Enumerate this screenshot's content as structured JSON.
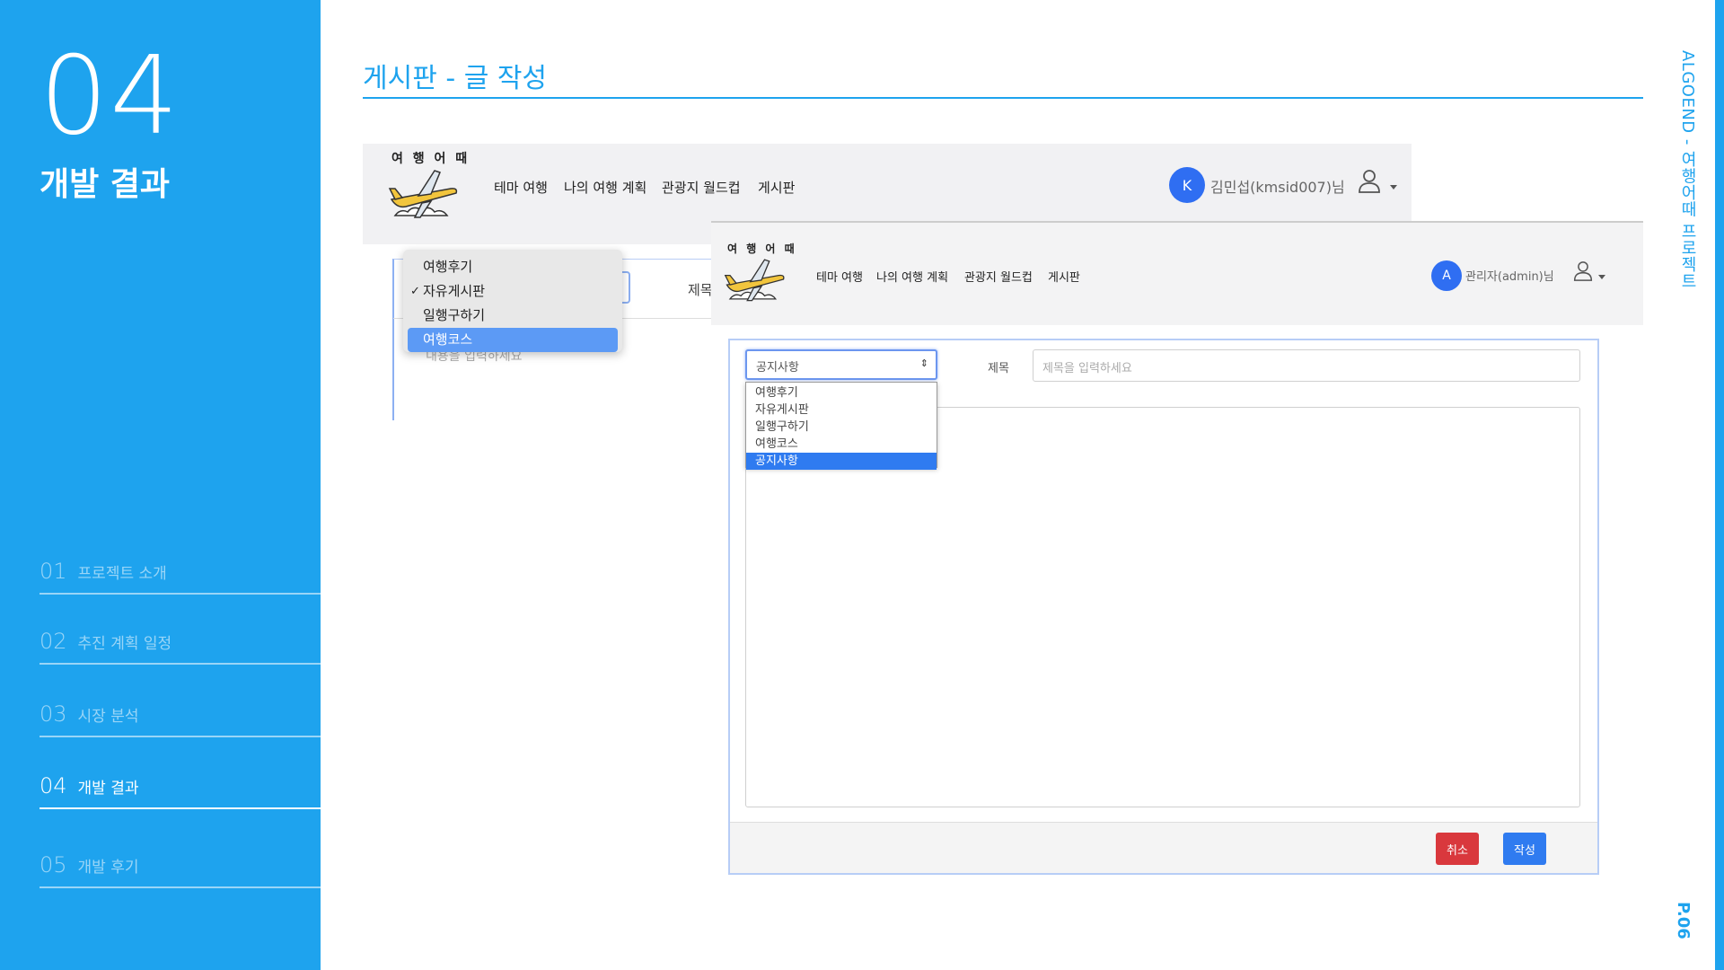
{
  "colors": {
    "accent": "#1ea3ee",
    "avatar_blue": "#2f6ef2",
    "cancel_red": "#d9383d",
    "write_blue": "#2f7bf0"
  },
  "sidebar": {
    "big_number": "04",
    "section_title": "개발 결과",
    "toc": [
      {
        "num": "01",
        "label": "프로젝트 소개"
      },
      {
        "num": "02",
        "label": "추진 계획 일정"
      },
      {
        "num": "03",
        "label": "시장 분석"
      },
      {
        "num": "04",
        "label": "개발 결과"
      },
      {
        "num": "05",
        "label": "개발 후기"
      }
    ],
    "active_index": 3
  },
  "side_label": "ALGOEND - 여행어때 프로젝트",
  "page_number": "P.06",
  "heading": "게시판 - 글 작성",
  "back_screen": {
    "logo_text": "여 행 어 때",
    "nav": [
      "테마 여행",
      "나의 여행 계획",
      "관광지 월드컵",
      "게시판"
    ],
    "avatar_letter": "K",
    "user_name": "김민섭(kmsid007)님",
    "title_label": "제목",
    "placeholder": "내용을 입력하세요",
    "dropdown_options": [
      "여행후기",
      "자유게시판",
      "일행구하기",
      "여행코스"
    ],
    "checked_option": "자유게시판",
    "highlighted_option": "여행코스",
    "check_mark": "✓"
  },
  "front_screen": {
    "logo_text": "여 행 어 때",
    "nav": [
      "테마 여행",
      "나의 여행 계획",
      "관광지 월드컵",
      "게시판"
    ],
    "avatar_letter": "A",
    "user_name": "관리자(admin)님",
    "select_value": "공지사항",
    "select_arrow": "⇕",
    "title_label": "제목",
    "title_placeholder": "제목을 입력하세요",
    "list_options": [
      "여행후기",
      "자유게시판",
      "일행구하기",
      "여행코스",
      "공지사항"
    ],
    "selected_option": "공지사항",
    "cancel_label": "취소",
    "write_label": "작성"
  }
}
